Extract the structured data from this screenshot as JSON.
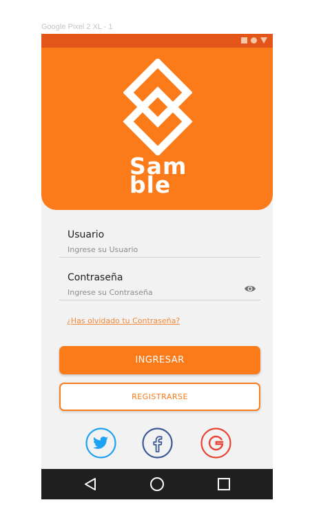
{
  "artboard": {
    "label": "Google Pixel 2 XL - 1"
  },
  "colors": {
    "accent": "#fb7a19",
    "status_bar": "#e2561a",
    "nav_bar": "#1f1f1f",
    "twitter": "#1da1f2",
    "facebook": "#3b5998",
    "google": "#e94235"
  },
  "status_bar": {
    "icons": [
      "square-icon",
      "circle-icon",
      "triangle-icon"
    ]
  },
  "brand": {
    "line1": "Sam",
    "line2": "ble"
  },
  "form": {
    "username_label": "Usuario",
    "username_placeholder": "Ingrese su Usuario",
    "password_label": "Contraseña",
    "password_placeholder": "Ingrese su Contraseña",
    "forgot_link": "¿Has olvidado tu Contraseña?",
    "login_button": "INGRESAR",
    "register_button": "REGISTRARSE"
  },
  "social": [
    "twitter-icon",
    "facebook-icon",
    "google-icon"
  ],
  "nav": [
    "back-icon",
    "home-icon",
    "recents-icon"
  ]
}
